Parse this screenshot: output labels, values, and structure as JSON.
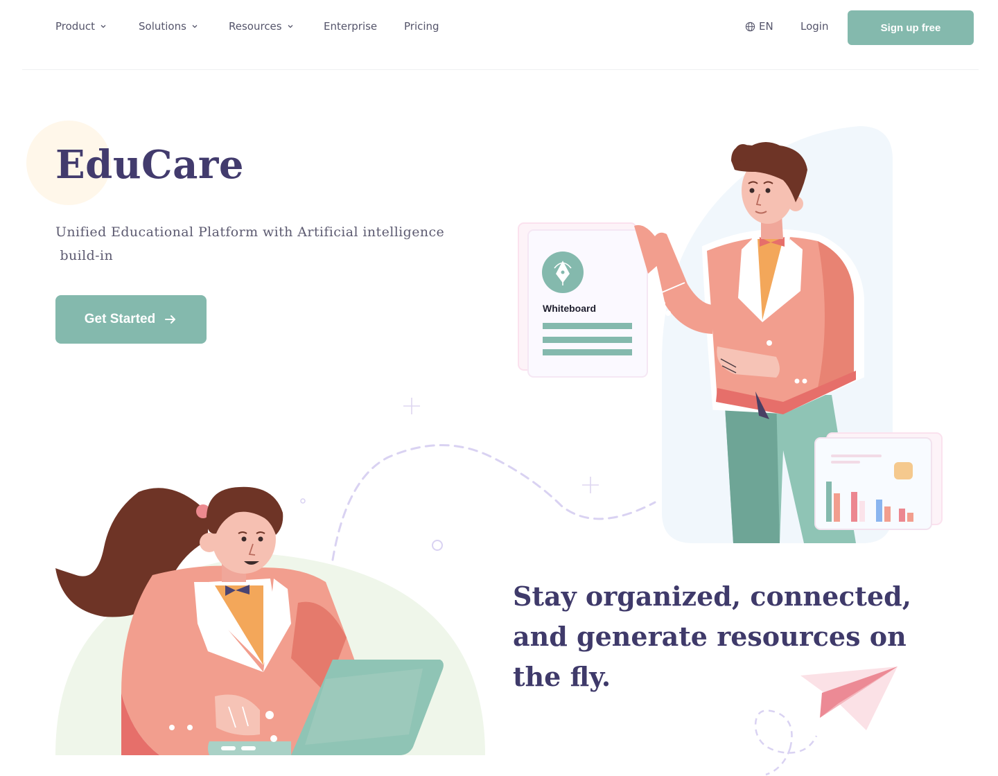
{
  "nav": {
    "items": [
      {
        "label": "Product",
        "has_dropdown": true
      },
      {
        "label": "Solutions",
        "has_dropdown": true
      },
      {
        "label": "Resources",
        "has_dropdown": true
      },
      {
        "label": "Enterprise",
        "has_dropdown": false
      },
      {
        "label": "Pricing",
        "has_dropdown": false
      }
    ],
    "language": "EN",
    "login": "Login",
    "signup": "Sign up free"
  },
  "hero": {
    "title": "EduCare",
    "subtitle_line1": "Unified Educational Platform with Artificial intelligence",
    "subtitle_line2": " build-in",
    "cta": "Get Started"
  },
  "card": {
    "label": "Whiteboard"
  },
  "tagline": {
    "line1": "Stay organized, connected,",
    "line2": "and generate resources on",
    "line3": "the fly."
  },
  "colors": {
    "accent": "#84b9ad",
    "heading": "#423b6d",
    "coral": "#f08f80"
  },
  "icons": {
    "language": "globe-icon",
    "cta": "arrow-right-icon",
    "dropdown": "chevron-down-icon",
    "card": "pen-nib-icon"
  }
}
